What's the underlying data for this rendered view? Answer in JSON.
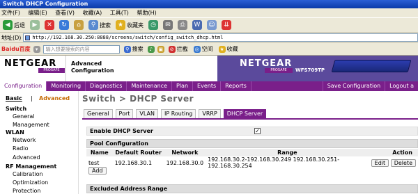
{
  "window": {
    "title": "Switch DHCP Configuration"
  },
  "menu": [
    "文件(F)",
    "编辑(E)",
    "查看(V)",
    "收藏(A)",
    "工具(T)",
    "帮助(H)"
  ],
  "toolbar": {
    "back": "后退",
    "search": "搜索",
    "favorites": "收藏夹"
  },
  "address": {
    "label": "地址(D)",
    "url": "http://192.168.30.250:8888/screens/switch/config_switch_dhcp.html"
  },
  "search_bar": {
    "brand": "Baidu百度",
    "placeholder": "输入想要搜索的内容",
    "search": "搜索",
    "interception": "拦截",
    "space": "空间",
    "favorites": "收藏"
  },
  "header": {
    "logo": "NETGEAR",
    "prosafe": "PROSAFE",
    "title_line1": "Advanced",
    "title_line2": "Configuration",
    "model": "WFS709TP"
  },
  "topnav": [
    "Configuration",
    "Monitoring",
    "Diagnostics",
    "Maintenance",
    "Plan",
    "Events",
    "Reports"
  ],
  "topnav_right": [
    "Save Configuration",
    "Logout a"
  ],
  "leftnav": {
    "basic": "Basic",
    "sep": "|",
    "advanced": "Advanced",
    "sections": [
      {
        "title": "Switch",
        "items": [
          "General",
          "Management"
        ]
      },
      {
        "title": "WLAN",
        "items": [
          "Network",
          "Radio",
          "Advanced"
        ]
      },
      {
        "title": "RF Management",
        "items": [
          "Calibration",
          "Optimization",
          "Protection"
        ]
      }
    ]
  },
  "page": {
    "title": "Switch > DHCP Server",
    "tabs": [
      "General",
      "Port",
      "VLAN",
      "IP Routing",
      "VRRP",
      "DHCP Server"
    ],
    "enable_label": "Enable DHCP Server",
    "enable_checked": "✓",
    "pool_header": "Pool Configuration",
    "columns": [
      "Name",
      "Default Router",
      "Network",
      "Range",
      "Action"
    ],
    "rows": [
      {
        "name": "test",
        "router": "192.168.30.1",
        "network": "192.168.30.0",
        "range": "192.168.30.2-192.168.30.249 192.168.30.251-192.168.30.254"
      }
    ],
    "edit": "Edit",
    "delete": "Delete",
    "add": "Add",
    "excluded_header": "Excluded Address Range"
  }
}
